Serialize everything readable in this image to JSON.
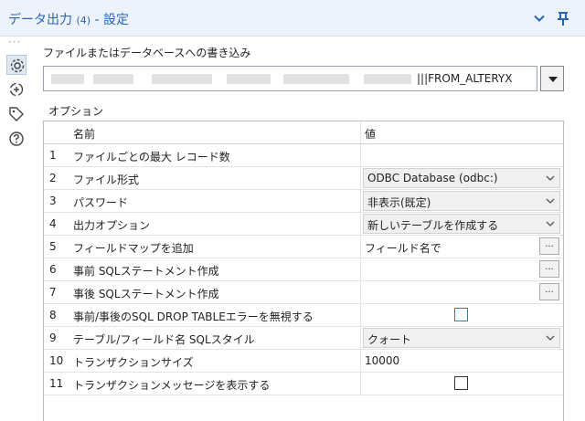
{
  "window": {
    "title": "データ出力",
    "count": "(4)",
    "subtitle": "- 設定"
  },
  "write_section": {
    "label": "ファイルまたはデータベースへの書き込み",
    "path_value": "|||FROM_ALTERYX"
  },
  "options_section": {
    "label": "オプション"
  },
  "grid": {
    "header_name": "名前",
    "header_value": "値",
    "rows": [
      {
        "num": "1",
        "name": "ファイルごとの最大 レコード数",
        "value": ""
      },
      {
        "num": "2",
        "name": "ファイル形式",
        "value": "ODBC Database (odbc:)"
      },
      {
        "num": "3",
        "name": "パスワード",
        "value": "非表示(既定)"
      },
      {
        "num": "4",
        "name": "出力オプション",
        "value": "新しいテーブルを作成する"
      },
      {
        "num": "5",
        "name": "フィールドマップを追加",
        "value": "フィールド名で",
        "button": "..."
      },
      {
        "num": "6",
        "name": "事前 SQLステートメント作成",
        "value": "",
        "button": "..."
      },
      {
        "num": "7",
        "name": "事後 SQLステートメント作成",
        "value": "",
        "button": "..."
      },
      {
        "num": "8",
        "name": "事前/事後のSQL DROP TABLEエラーを無視する",
        "checked": false
      },
      {
        "num": "9",
        "name": "テーブル/フィールド名 SQLスタイル",
        "value": "クォート"
      },
      {
        "num": "10",
        "name": "トランザクションサイズ",
        "value": "10000"
      },
      {
        "num": "11",
        "name": "トランザクションメッセージを表示する",
        "checked": false
      }
    ]
  },
  "icons": {
    "collapse": "chevron-down-icon",
    "pin": "pin-icon",
    "settings": "gear-icon",
    "connections": "connection-icon",
    "annotation": "tag-icon",
    "help": "help-icon"
  },
  "colors": {
    "accent": "#2a63b8",
    "titlebar_bg": "#eef3fb",
    "checkbox_focus": "#2b7bd6"
  }
}
